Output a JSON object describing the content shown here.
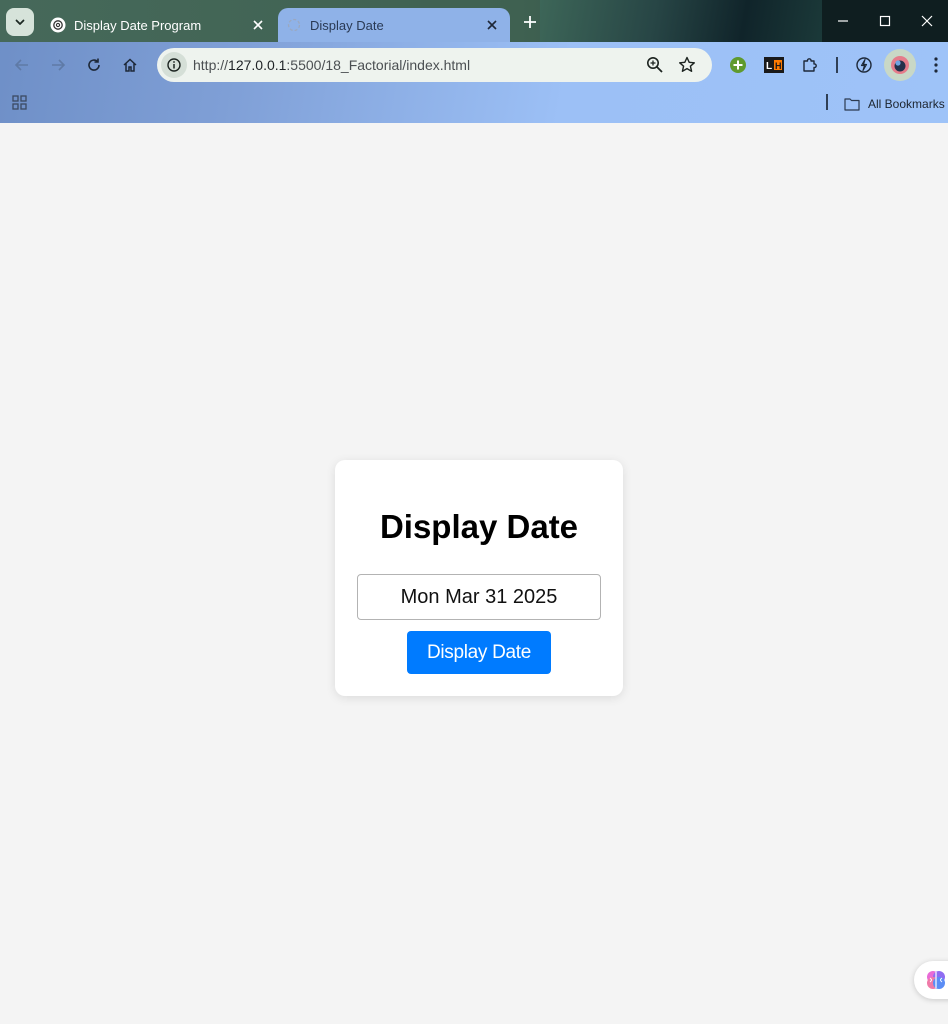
{
  "browser": {
    "tabs": [
      {
        "title": "Display Date Program",
        "active": false
      },
      {
        "title": "Display Date",
        "active": true
      }
    ],
    "address_bar": {
      "url_host": "127.0.0.1",
      "url_prefix": "http://",
      "url_suffix": ":5500/18_Factorial/index.html"
    },
    "bookmarks": {
      "folder_label": "All Bookmarks"
    },
    "extensions": [
      "plus-extension-icon",
      "lighthouse-extension-icon",
      "puzzle-extension-icon",
      "sync-extension-icon"
    ],
    "colors": {
      "tab_strip": "#46695a",
      "toolbar": "#9ec3f8",
      "omnibox": "#eef3ee"
    }
  },
  "page": {
    "heading": "Display Date",
    "date_field_value": "Mon Mar 31 2025",
    "button_label": "Display Date",
    "colors": {
      "background": "#f4f4f4",
      "card": "#ffffff",
      "button": "#007bff"
    }
  }
}
